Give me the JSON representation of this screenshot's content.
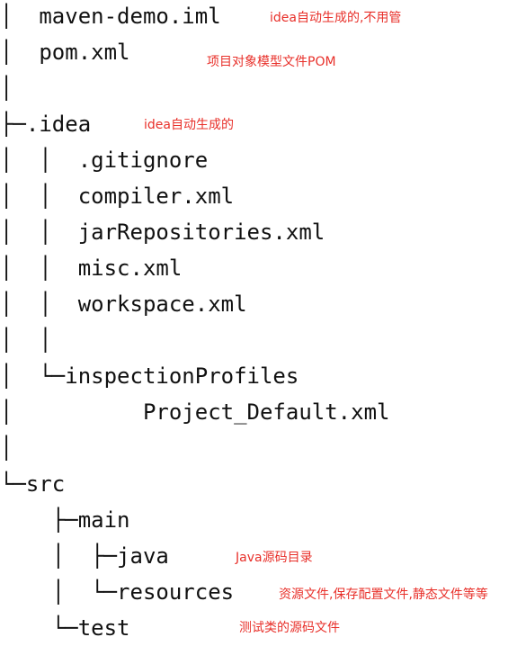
{
  "tree": {
    "lines": [
      "│  maven-demo.iml",
      "│  pom.xml",
      "│",
      "├─.idea",
      "│  │  .gitignore",
      "│  │  compiler.xml",
      "│  │  jarRepositories.xml",
      "│  │  misc.xml",
      "│  │  workspace.xml",
      "│  │",
      "│  └─inspectionProfiles",
      "│          Project_Default.xml",
      "│",
      "└─src",
      "    ├─main",
      "    │  ├─java",
      "    │  └─resources",
      "    └─test"
    ]
  },
  "annotations": {
    "color": "#e8302a",
    "iml": "idea自动生成的,不用管",
    "pom": "项目对象模型文件POM",
    "idea": "idea自动生成的",
    "java": "Java源码目录",
    "resources": "资源文件,保存配置文件,静态文件等等",
    "test": "测试类的源码文件"
  }
}
